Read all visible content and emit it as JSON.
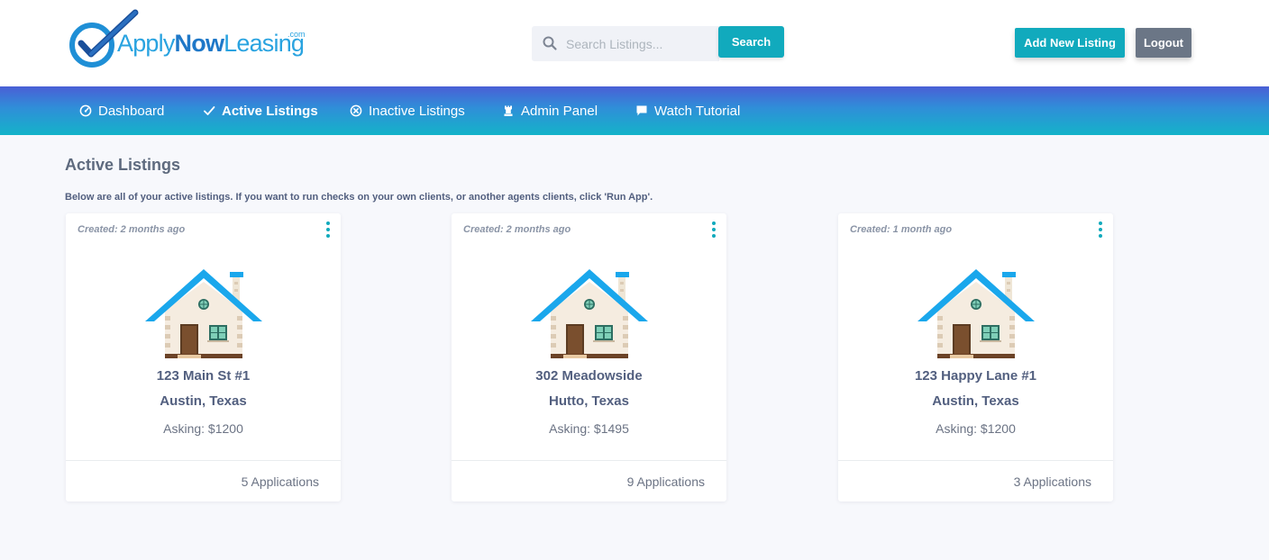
{
  "logo": {
    "apply": "Apply",
    "now": "Now",
    "leasing": "Leasing",
    "com": ".com"
  },
  "search": {
    "placeholder": "Search Listings...",
    "button_label": "Search",
    "icon": "search-icon"
  },
  "header_actions": {
    "add_listing_label": "Add New Listing",
    "logout_label": "Logout"
  },
  "nav": {
    "items": [
      {
        "label": "Dashboard",
        "icon": "speedometer-icon",
        "active": false
      },
      {
        "label": "Active Listings",
        "icon": "check-icon",
        "active": true
      },
      {
        "label": "Inactive Listings",
        "icon": "x-circle-icon",
        "active": false
      },
      {
        "label": "Admin Panel",
        "icon": "chess-rook-icon",
        "active": false
      },
      {
        "label": "Watch Tutorial",
        "icon": "chat-flag-icon",
        "active": false
      }
    ]
  },
  "page": {
    "title": "Active Listings",
    "description": "Below are all of your active listings. If you want to run checks on your own clients, or another agents clients, click 'Run App'."
  },
  "listings": [
    {
      "created": "Created: 2 months ago",
      "street": "123 Main St #1",
      "city": "Austin, Texas",
      "asking": "Asking: $1200",
      "applications": "5 Applications"
    },
    {
      "created": "Created: 2 months ago",
      "street": "302 Meadowside",
      "city": "Hutto, Texas",
      "asking": "Asking: $1495",
      "applications": "9 Applications"
    },
    {
      "created": "Created: 1 month ago",
      "street": "123 Happy Lane #1",
      "city": "Austin, Texas",
      "asking": "Asking: $1200",
      "applications": "3 Applications"
    }
  ],
  "colors": {
    "accent": "#11aabd",
    "logout": "#6b7686",
    "nav_gradient_top": "#4a5fd6",
    "nav_gradient_bottom": "#14b3c9",
    "roof": "#1aa7ec"
  }
}
